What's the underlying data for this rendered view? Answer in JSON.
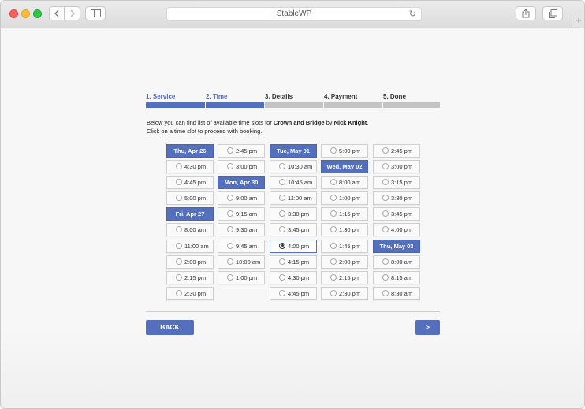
{
  "browser": {
    "url": "StableWP",
    "reload_icon": "reload-icon",
    "back_icon": "chevron-left-icon",
    "forward_icon": "chevron-right-icon",
    "sidebar_icon": "sidebar-icon",
    "share_icon": "share-icon",
    "tabs_icon": "tabs-icon",
    "new_tab_icon": "plus-icon",
    "new_tab_label": "+"
  },
  "steps": [
    {
      "label": "1. Service",
      "active": true
    },
    {
      "label": "2. Time",
      "active": true
    },
    {
      "label": "3. Details",
      "active": false
    },
    {
      "label": "4. Payment",
      "active": false
    },
    {
      "label": "5. Done",
      "active": false
    }
  ],
  "intro": {
    "line1_prefix": "Below you can find list of available time slots for ",
    "service": "Crown and Bridge",
    "line1_mid": " by ",
    "staff": "Nick Knight",
    "line1_suffix": ".",
    "line2": "Click on a time slot to proceed with booking."
  },
  "columns": [
    [
      {
        "type": "date",
        "label": "Thu, Apr 26"
      },
      {
        "type": "slot",
        "label": "4:30 pm"
      },
      {
        "type": "slot",
        "label": "4:45 pm"
      },
      {
        "type": "slot",
        "label": "5:00 pm"
      },
      {
        "type": "date",
        "label": "Fri, Apr 27"
      },
      {
        "type": "slot",
        "label": "8:00 am"
      },
      {
        "type": "slot",
        "label": "11:00 am"
      },
      {
        "type": "slot",
        "label": "2:00 pm"
      },
      {
        "type": "slot",
        "label": "2:15 pm"
      },
      {
        "type": "slot",
        "label": "2:30 pm"
      }
    ],
    [
      {
        "type": "slot",
        "label": "2:45 pm"
      },
      {
        "type": "slot",
        "label": "3:00 pm"
      },
      {
        "type": "date",
        "label": "Mon, Apr 30"
      },
      {
        "type": "slot",
        "label": "9:00 am"
      },
      {
        "type": "slot",
        "label": "9:15 am"
      },
      {
        "type": "slot",
        "label": "9:30 am"
      },
      {
        "type": "slot",
        "label": "9:45 am"
      },
      {
        "type": "slot",
        "label": "10:00 am"
      },
      {
        "type": "slot",
        "label": "1:00 pm"
      }
    ],
    [
      {
        "type": "date",
        "label": "Tue, May 01"
      },
      {
        "type": "slot",
        "label": "10:30 am"
      },
      {
        "type": "slot",
        "label": "10:45 am"
      },
      {
        "type": "slot",
        "label": "11:00 am"
      },
      {
        "type": "slot",
        "label": "3:30 pm"
      },
      {
        "type": "slot",
        "label": "3:45 pm"
      },
      {
        "type": "slot",
        "label": "4:00 pm",
        "selected": true
      },
      {
        "type": "slot",
        "label": "4:15 pm"
      },
      {
        "type": "slot",
        "label": "4:30 pm"
      },
      {
        "type": "slot",
        "label": "4:45 pm"
      }
    ],
    [
      {
        "type": "slot",
        "label": "5:00 pm"
      },
      {
        "type": "date",
        "label": "Wed, May 02"
      },
      {
        "type": "slot",
        "label": "8:00 am"
      },
      {
        "type": "slot",
        "label": "1:00 pm"
      },
      {
        "type": "slot",
        "label": "1:15 pm"
      },
      {
        "type": "slot",
        "label": "1:30 pm"
      },
      {
        "type": "slot",
        "label": "1:45 pm"
      },
      {
        "type": "slot",
        "label": "2:00 pm"
      },
      {
        "type": "slot",
        "label": "2:15 pm"
      },
      {
        "type": "slot",
        "label": "2:30 pm"
      }
    ],
    [
      {
        "type": "slot",
        "label": "2:45 pm"
      },
      {
        "type": "slot",
        "label": "3:00 pm"
      },
      {
        "type": "slot",
        "label": "3:15 pm"
      },
      {
        "type": "slot",
        "label": "3:30 pm"
      },
      {
        "type": "slot",
        "label": "3:45 pm"
      },
      {
        "type": "slot",
        "label": "4:00 pm"
      },
      {
        "type": "date",
        "label": "Thu, May 03"
      },
      {
        "type": "slot",
        "label": "8:00 am"
      },
      {
        "type": "slot",
        "label": "8:15 am"
      },
      {
        "type": "slot",
        "label": "8:30 am"
      }
    ]
  ],
  "buttons": {
    "back_label": "BACK",
    "next_label": ">"
  },
  "colors": {
    "accent": "#5470bc",
    "inactive_step": "#c4c4c4"
  }
}
